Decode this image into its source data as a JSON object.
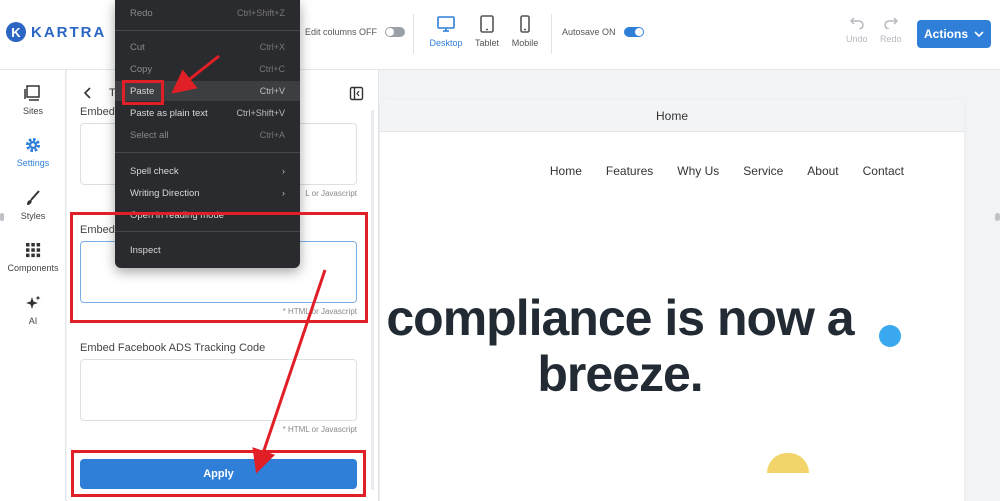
{
  "brand": {
    "logo_letter": "K",
    "name": "KARTRA"
  },
  "toolbar": {
    "edit_columns_label": "Edit columns OFF",
    "devices": [
      {
        "label": "Desktop",
        "icon": "desktop-icon",
        "active": true
      },
      {
        "label": "Tablet",
        "icon": "tablet-icon",
        "active": false
      },
      {
        "label": "Mobile",
        "icon": "mobile-icon",
        "active": false
      }
    ],
    "autosave_label": "Autosave ON",
    "undo_label": "Undo",
    "redo_label": "Redo",
    "actions_label": "Actions"
  },
  "sidebar": {
    "items": [
      {
        "label": "Sites",
        "icon": "sites-icon"
      },
      {
        "label": "Settings",
        "icon": "gear-icon",
        "active": true
      },
      {
        "label": "Styles",
        "icon": "brush-icon"
      },
      {
        "label": "Components",
        "icon": "grid-icon"
      },
      {
        "label": "AI",
        "icon": "sparkle-icon"
      }
    ]
  },
  "panel": {
    "title": "T",
    "fields": [
      {
        "label": "Embed",
        "hint": "L or Javascript"
      },
      {
        "label": "Embed",
        "hint": "* HTML or Javascript"
      },
      {
        "label": "Embed Facebook ADS Tracking Code",
        "hint": "* HTML or Javascript"
      }
    ],
    "apply_label": "Apply"
  },
  "context_menu": {
    "items": [
      {
        "label": "Redo",
        "shortcut": "Ctrl+Shift+Z",
        "dim": true
      },
      {
        "label": "Cut",
        "shortcut": "Ctrl+X",
        "dim": true
      },
      {
        "label": "Copy",
        "shortcut": "Ctrl+C",
        "dim": true
      },
      {
        "label": "Paste",
        "shortcut": "Ctrl+V",
        "highlighted": true
      },
      {
        "label": "Paste as plain text",
        "shortcut": "Ctrl+Shift+V"
      },
      {
        "label": "Select all",
        "shortcut": "Ctrl+A",
        "dim": true
      },
      {
        "label": "Spell check",
        "submenu": true
      },
      {
        "label": "Writing Direction",
        "submenu": true
      },
      {
        "label": "Open in reading mode"
      },
      {
        "label": "Inspect"
      }
    ]
  },
  "preview": {
    "page_name": "Home",
    "nav": [
      "Home",
      "Features",
      "Why Us",
      "Service",
      "About",
      "Contact"
    ],
    "hero_line1": "compliance is now a",
    "hero_line2": "breeze."
  },
  "colors": {
    "accent": "#2f7fd8",
    "annotation": "#e01f26",
    "menu_bg": "#2a2b2e"
  }
}
